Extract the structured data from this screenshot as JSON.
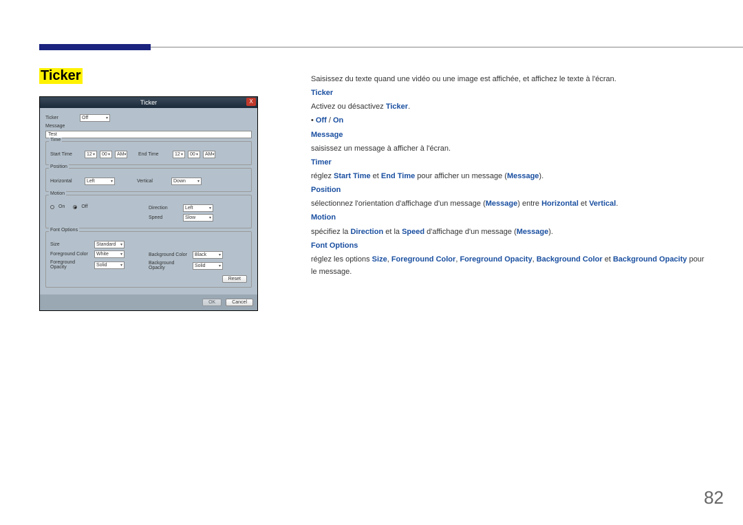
{
  "page": {
    "title": "Ticker",
    "number": "82"
  },
  "dialog": {
    "title": "Ticker",
    "close": "X",
    "ticker": {
      "label": "Ticker",
      "value": "Off"
    },
    "message": {
      "label": "Message",
      "value": "Test"
    },
    "time": {
      "legend": "Time",
      "startLabel": "Start Time",
      "sh": "12",
      "sm": "00",
      "sap": "AM",
      "endLabel": "End Time",
      "eh": "12",
      "em": "00",
      "eap": "AM"
    },
    "position": {
      "legend": "Position",
      "hLabel": "Horizontal",
      "hVal": "Left",
      "vLabel": "Vertical",
      "vVal": "Down"
    },
    "motion": {
      "legend": "Motion",
      "onLabel": "On",
      "offLabel": "Off",
      "selected": "Off",
      "dirLabel": "Direction",
      "dirVal": "Left",
      "spdLabel": "Speed",
      "spdVal": "Slow"
    },
    "font": {
      "legend": "Font Options",
      "sizeLabel": "Size",
      "sizeVal": "Standard",
      "fgcLabel": "Foreground Color",
      "fgcVal": "White",
      "fgoLabel": "Foreground Opacity",
      "fgoVal": "Solid",
      "bgcLabel": "Background Color",
      "bgcVal": "Black",
      "bgoLabel": "Background Opacity",
      "bgoVal": "Solid",
      "reset": "Reset"
    },
    "ok": "OK",
    "cancel": "Cancel"
  },
  "article": {
    "intro": "Saisissez du texte quand une vidéo ou une image est affichée, et affichez le texte à l'écran.",
    "h_ticker": "Ticker",
    "p_ticker_a": "Activez ou désactivez ",
    "p_ticker_b": "Ticker",
    "p_ticker_c": ".",
    "bul_pre": "• ",
    "off": "Off",
    "slash": " / ",
    "on": "On",
    "h_message": "Message",
    "p_message": "saisissez un message à afficher à l'écran.",
    "h_timer": "Timer",
    "p_timer_a": "réglez ",
    "p_timer_b": "Start Time",
    "p_timer_c": " et ",
    "p_timer_d": "End Time",
    "p_timer_e": " pour afficher un message (",
    "p_timer_f": "Message",
    "p_timer_g": ").",
    "h_position": "Position",
    "p_pos_a": "sélectionnez l'orientation d'affichage d'un message (",
    "p_pos_b": "Message",
    "p_pos_c": ") entre ",
    "p_pos_d": "Horizontal",
    "p_pos_e": " et ",
    "p_pos_f": "Vertical",
    "p_pos_g": ".",
    "h_motion": "Motion",
    "p_mot_a": "spécifiez la ",
    "p_mot_b": "Direction",
    "p_mot_c": " et la ",
    "p_mot_d": "Speed",
    "p_mot_e": " d'affichage d'un message (",
    "p_mot_f": "Message",
    "p_mot_g": ").",
    "h_font": "Font Options",
    "p_font_a": "réglez les options ",
    "p_font_b": "Size",
    "p_font_c": ", ",
    "p_font_d": "Foreground Color",
    "p_font_e": ", ",
    "p_font_f": "Foreground Opacity",
    "p_font_g": ", ",
    "p_font_h": "Background Color",
    "p_font_i": " et ",
    "p_font_j": "Background Opacity",
    "p_font_k": " pour le message."
  }
}
